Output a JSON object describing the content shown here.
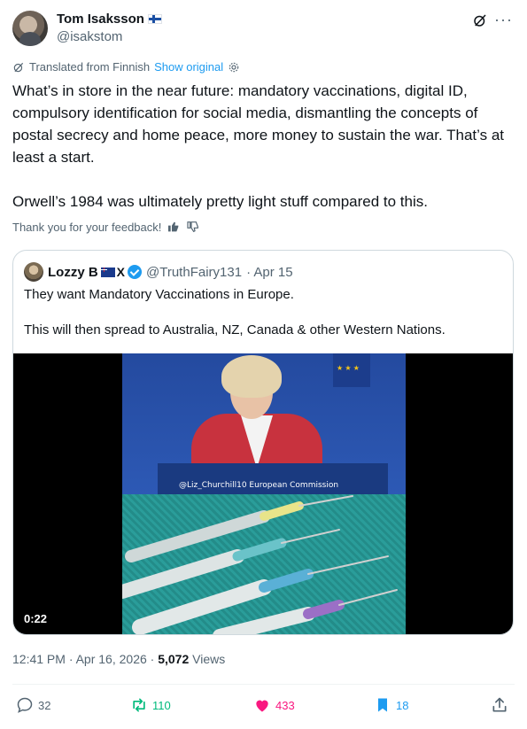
{
  "author": {
    "name": "Tom Isaksson",
    "handle": "@isakstom"
  },
  "translation": {
    "label": "Translated from Finnish",
    "link": "Show original"
  },
  "tweet_text": "What’s in store in the near future: mandatory vaccinations, digital ID, compulsory identification for social media, dismantling the concepts of postal secrecy and home peace, more money to sustain the war. That’s at least a start.\n\nOrwell’s 1984 was ultimately pretty light stuff compared to this.",
  "feedback": "Thank you for your feedback!",
  "quote": {
    "name": "Lozzy B",
    "x_badge": "X",
    "handle": "@TruthFairy131",
    "date": "· Apr 15",
    "text": "They want Mandatory Vaccinations in Europe.\n\nThis will then spread to Australia, NZ, Canada & other Western Nations.",
    "video_caption": "@Liz_Churchill10  European Commission",
    "video_time": "0:22"
  },
  "meta": {
    "time": "12:41 PM · Apr 16, 2026 ·",
    "views_count": "5,072",
    "views_label": "Views"
  },
  "actions": {
    "replies": "32",
    "reposts": "110",
    "likes": "433",
    "bookmarks": "18"
  },
  "colors": {
    "accent": "#1d9bf0",
    "repost": "#00ba7c",
    "like": "#f91880",
    "muted": "#536471"
  }
}
